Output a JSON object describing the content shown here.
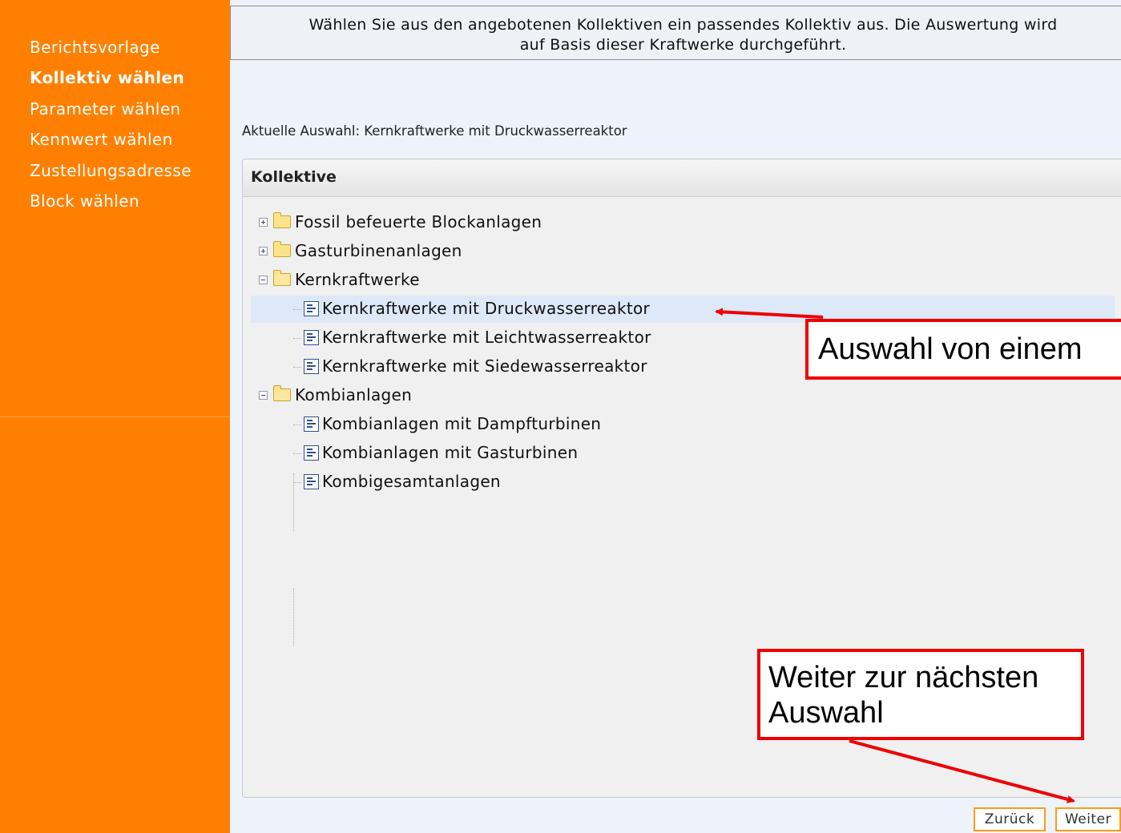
{
  "sidebar": {
    "items": [
      {
        "label": "Berichtsvorlage",
        "active": false
      },
      {
        "label": "Kollektiv wählen",
        "active": true
      },
      {
        "label": "Parameter wählen",
        "active": false
      },
      {
        "label": "Kennwert wählen",
        "active": false
      },
      {
        "label": "Zustellungsadresse",
        "active": false
      },
      {
        "label": "Block wählen",
        "active": false
      }
    ]
  },
  "info": {
    "line1": "Wählen Sie aus den angebotenen Kollektiven ein passendes Kollektiv aus. Die Auswertung wird",
    "line2": "auf Basis dieser Kraftwerke durchgeführt."
  },
  "current_selection": "Aktuelle Auswahl: Kernkraftwerke mit Druckwasserreaktor",
  "panel": {
    "title": "Kollektive",
    "tree": [
      {
        "label": "Fossil befeuerte Blockanlagen",
        "expanded": false,
        "children": []
      },
      {
        "label": "Gasturbinenanlagen",
        "expanded": false,
        "children": []
      },
      {
        "label": "Kernkraftwerke",
        "expanded": true,
        "children": [
          {
            "label": "Kernkraftwerke mit Druckwasserreaktor",
            "selected": true
          },
          {
            "label": "Kernkraftwerke mit Leichtwasserreaktor",
            "selected": false
          },
          {
            "label": "Kernkraftwerke mit Siedewasserreaktor",
            "selected": false
          }
        ]
      },
      {
        "label": "Kombianlagen",
        "expanded": true,
        "children": [
          {
            "label": "Kombianlagen mit Dampfturbinen",
            "selected": false
          },
          {
            "label": "Kombianlagen mit Gasturbinen",
            "selected": false
          },
          {
            "label": "Kombigesamtanlagen",
            "selected": false
          }
        ]
      }
    ]
  },
  "buttons": {
    "back": "Zurück",
    "next": "Weiter"
  },
  "annotations": {
    "callout1": "Auswahl von einem",
    "callout2_line1": "Weiter zur nächsten",
    "callout2_line2": "Auswahl"
  },
  "colors": {
    "sidebar": "#ff8000",
    "selection": "#dde8f8",
    "annotation": "#ee0000",
    "button_border": "#ff9a1a"
  }
}
